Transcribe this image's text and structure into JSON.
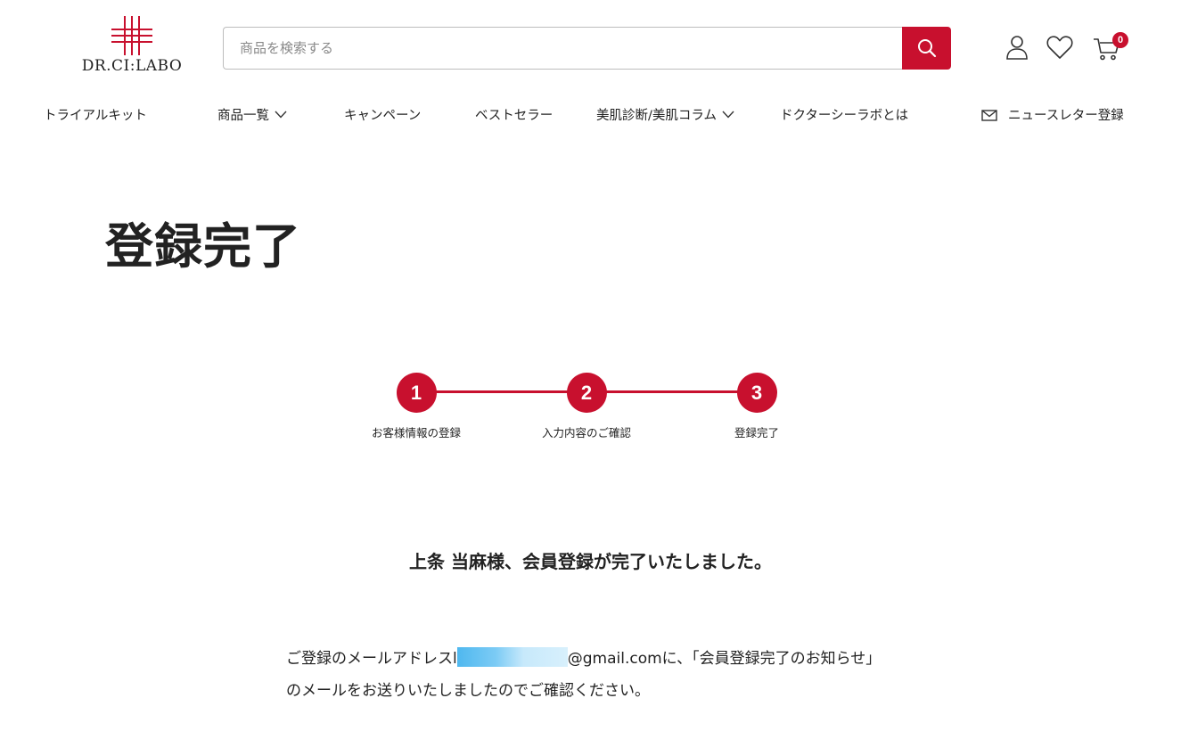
{
  "header": {
    "logo_text": "DR.CI:LABO",
    "search": {
      "placeholder": "商品を検索する",
      "value": ""
    },
    "cart_count": "0",
    "icons": [
      "search-icon",
      "user-icon",
      "heart-icon",
      "cart-icon"
    ]
  },
  "nav": {
    "items": [
      {
        "label": "トライアルキット"
      },
      {
        "label": "商品一覧"
      },
      {
        "label": "キャンペーン"
      },
      {
        "label": "ベストセラー"
      },
      {
        "label": "美肌診断/美肌コラム"
      },
      {
        "label": "ドクターシーラボとは"
      },
      {
        "label": "ニュースレター登録"
      }
    ]
  },
  "main": {
    "title": "登録完了",
    "steps": [
      {
        "number": "1",
        "label": "お客様情報の登録"
      },
      {
        "number": "2",
        "label": "入力内容のご確認"
      },
      {
        "number": "3",
        "label": "登録完了"
      }
    ],
    "complete_heading": "上条 当麻様、会員登録が完了いたしました。",
    "message_part1": "ご登録のメールアドレスl",
    "message_part2": "@gmail.comに、「会員登録完了のお知らせ」のメールをお送りいたしましたのでご確認ください。"
  },
  "colors": {
    "brand_red": "#c8102e",
    "text": "#222222",
    "redaction": "#4fb8ef"
  }
}
